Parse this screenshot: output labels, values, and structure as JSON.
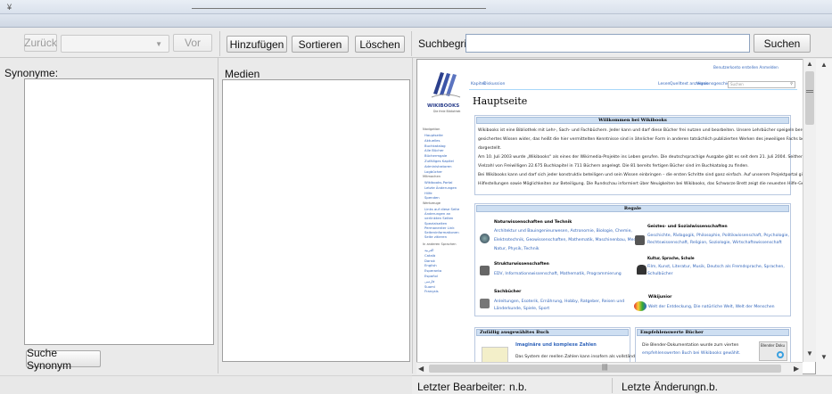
{
  "titlebar": {
    "icon": "¥"
  },
  "toolbar": {
    "back_label": "Zurück",
    "forward_label": "Vor",
    "combo_value": "",
    "add_label": "Hinzufügen",
    "sort_label": "Sortieren",
    "delete_label": "Löschen",
    "search_label": "Suchbegriff:",
    "search_value": "",
    "search_button": "Suchen"
  },
  "synonyms": {
    "title": "Synonyme:",
    "search_button": "Suche Synonym"
  },
  "media": {
    "title": "Medien"
  },
  "status": {
    "last_editor_label": "Letzter Bearbeiter:",
    "last_editor_value": "n.b.",
    "last_change_label": "Letzte Änderung:",
    "last_change_value": "n.b."
  },
  "wiki": {
    "logo_text": "WIKIBOOKS",
    "logo_sub": "Die freie Bibliothek",
    "top_links": "Benutzerkonto erstellen   Anmelden",
    "tab_kapitel": "Kapitel",
    "tab_diskussion": "Diskussion",
    "tab_lesen": "Lesen",
    "tab_quelltext": "Quelltext anzeigen",
    "tab_versionen": "Versionsgeschichte",
    "search_placeholder": "Suchen",
    "page_title": "Hauptseite",
    "welcome_header": "Willkommen bei Wikibooks",
    "welcome_lines": [
      "Wikibooks ist eine Bibliothek mit Lehr-, Sach- und Fachbüchern. Jeder kann und darf diese Bücher frei nutzen und bearbeiten. Unsere Lehrbücher speigeln bereits",
      "gesichertes Wissen wider, das heißt die hier vermittelten Kenntnisse sind in ähnlicher Form in anderen tatsächlich publizierten Werken des jeweiligen Fachs bereits",
      "dargestellt.",
      "Am 10. Juli 2003 wurde „Wikibooks“ als eines der Wikimedia-Projekte ins Leben gerufen. Die deutschsprachige Ausgabe gibt es seit dem 21. Juli 2004. Seither hat eine",
      "Vielzahl von Freiwilligen 22.675 Buchkapitel in 711 Büchern angelegt. Die 81 bereits fertigen Bücher sind im Buchkatalog zu finden.",
      "Bei Wikibooks kann und darf sich jeder konstruktiv beteiligen und sein Wissen einbringen – die ersten Schritte sind ganz einfach. Auf unserem Projektportal gibt es weitere",
      "Hilfestellungen sowie Möglichkeiten zur Beteiligung. Die Rundschau informiert über Neuigkeiten bei Wikibooks, das Schwarze Brett zeigt die neuesten Hilfe-Gesuche auf."
    ],
    "shelves_header": "Regale",
    "shelf_nat_title": "Naturwissenschaften und Technik",
    "shelf_nat_text": [
      "Architektur und Bauingenieurwesen, Astronomie, Biologie, Chemie,",
      "Elektrotechnik, Geowissenschaften, Mathematik, Maschinenbau, Medizin,",
      "Natur, Physik, Technik"
    ],
    "shelf_geist_title": "Geistes- und Sozialwissenschaften",
    "shelf_geist_text": [
      "Geschichte, Pädagogik, Philosophie, Politikwissenschaft, Psychologie,",
      "Rechtswissenschaft, Religion, Soziologie, Wirtschaftswissenschaft"
    ],
    "shelf_struk_title": "Strukturwissenschaften",
    "shelf_struk_text": "EDV, Informationswissenschaft, Mathematik, Programmierung",
    "shelf_kultur_title": "Kultur, Sprache, Schule",
    "shelf_kultur_text": [
      "Film, Kunst, Literatur, Musik, Deutsch als Fremdsprache, Sprachen,",
      "Schulbücher"
    ],
    "shelf_sach_title": "Sachbücher",
    "shelf_sach_text": [
      "Anleitungen, Esoterik, Ernährung, Hobby, Ratgeber, Reisen und",
      "Länderkunde, Spiele, Sport"
    ],
    "shelf_junior_title": "Wikijunior",
    "shelf_junior_text": "Welt der Entdeckung, Die natürliche Welt, Welt der Menschen",
    "random_header": "Zufällig ausgewähltes Buch",
    "random_title": "Imaginäre und komplexe Zahlen",
    "random_text": "Das System der reellen Zahlen kann insofern als vollständig und nicht",
    "recommended_header": "Empfehlenswerte Bücher",
    "recommended_text": [
      "Die Blender-Dokumentation wurde zum vierten",
      "empfehlenswerten Buch bei Wikibooks gewählt."
    ],
    "recommended_badge": "Blender Doku",
    "nav_heading": "Navigation",
    "nav_items": [
      "Hauptseite",
      "Aktuelles",
      "Buchkatalog",
      "Alle Bücher",
      "Büchermgale",
      "Zufälliges Kapitel",
      "Administratoren",
      "Logbücher"
    ],
    "mit_heading": "Mitmachen",
    "mit_items": [
      "Wikibooks-Portal",
      "Letzte Änderungen",
      "Hilfe",
      "Spenden"
    ],
    "tool_heading": "Werkzeuge",
    "tool_items": [
      "Links auf diese Seite",
      "Änderungen an",
      "verlinkten Seiten",
      "Spezialseiten",
      "Permanenter Link",
      "Seiteninformationen",
      "Seite zitieren"
    ],
    "lang_heading": "In anderen Sprachen",
    "lang_items": [
      "العربية",
      "Català",
      "Dansk",
      "English",
      "Esperanto",
      "Español",
      "فارسی",
      "Suomi",
      "Français"
    ]
  }
}
